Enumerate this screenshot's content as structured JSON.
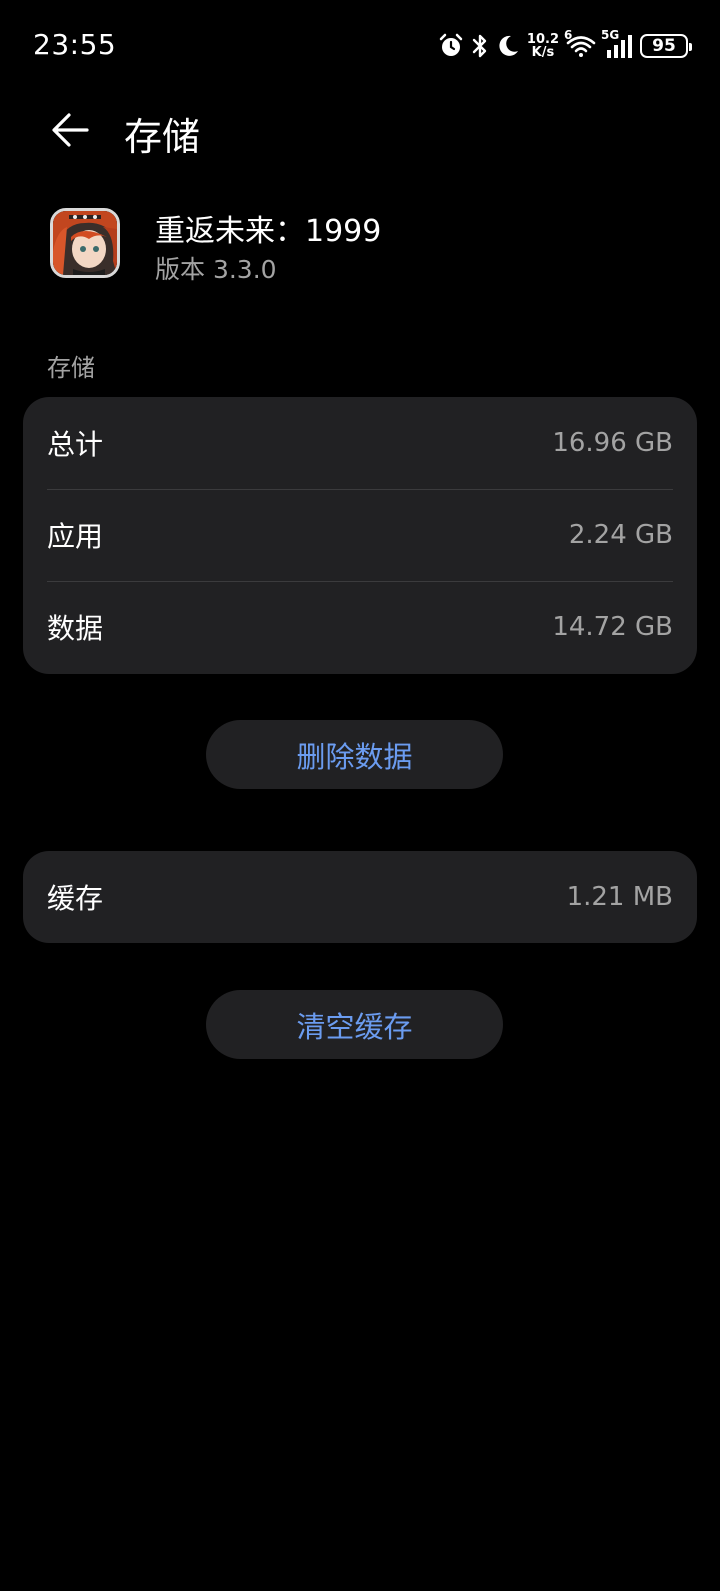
{
  "status_bar": {
    "time": "23:55",
    "net_speed_value": "10.2",
    "net_speed_unit": "K/s",
    "wifi_label": "6",
    "signal_label": "5G",
    "battery": "95",
    "icons": [
      "alarm-icon",
      "bluetooth-icon",
      "moon-icon",
      "wifi-icon",
      "signal-icon",
      "battery-icon"
    ]
  },
  "header": {
    "title": "存储",
    "back_icon": "back-arrow-icon"
  },
  "app": {
    "name": "重返未来：1999",
    "version": "版本 3.3.0"
  },
  "storage": {
    "section_label": "存储",
    "rows": [
      {
        "label": "总计",
        "value": "16.96 GB"
      },
      {
        "label": "应用",
        "value": "2.24 GB"
      },
      {
        "label": "数据",
        "value": "14.72 GB"
      }
    ],
    "delete_button": "删除数据"
  },
  "cache": {
    "label": "缓存",
    "value": "1.21 MB",
    "clear_button": "清空缓存"
  },
  "colors": {
    "background": "#000000",
    "card": "#212123",
    "accent": "#6b9cf0",
    "secondary_text": "#a3a3a3"
  }
}
